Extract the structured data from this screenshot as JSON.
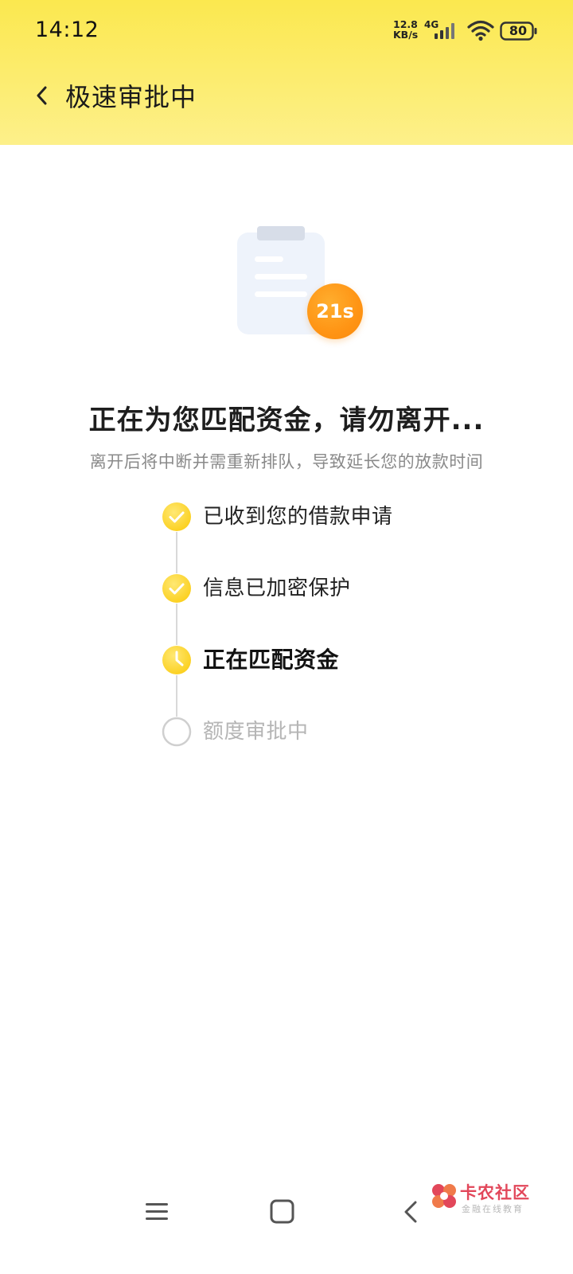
{
  "status_bar": {
    "time": "14:12",
    "net_speed": "12.8",
    "net_unit": "KB/s",
    "network_type": "4G",
    "battery": "80",
    "icons": [
      "signal-icon",
      "wifi-icon",
      "battery-icon"
    ]
  },
  "header": {
    "title": "极速审批中",
    "back_icon": "chevron-left-icon",
    "background_colors": [
      "#fbe84f",
      "#fdf08a"
    ]
  },
  "timer": {
    "label": "21s",
    "color": "#ff9414"
  },
  "main": {
    "headline": "正在为您匹配资金，请勿离开...",
    "subline": "离开后将中断并需重新排队，导致延长您的放款时间"
  },
  "steps": [
    {
      "label": "已收到您的借款申请",
      "status": "done",
      "icon": "check-circle-icon"
    },
    {
      "label": "信息已加密保护",
      "status": "done",
      "icon": "check-circle-icon"
    },
    {
      "label": "正在匹配资金",
      "status": "active",
      "icon": "clock-icon"
    },
    {
      "label": "额度审批中",
      "status": "pending",
      "icon": "empty-circle-icon"
    }
  ],
  "colors": {
    "accent_yellow": "#fbd52a",
    "step_line": "#d9d9d9",
    "pending_gray": "#b5b5b5"
  },
  "watermark": {
    "title": "卡农社区",
    "subtitle": "金融在线教育"
  },
  "nav_bar": {
    "icons": [
      "menu-icon",
      "home-icon",
      "back-icon"
    ]
  }
}
